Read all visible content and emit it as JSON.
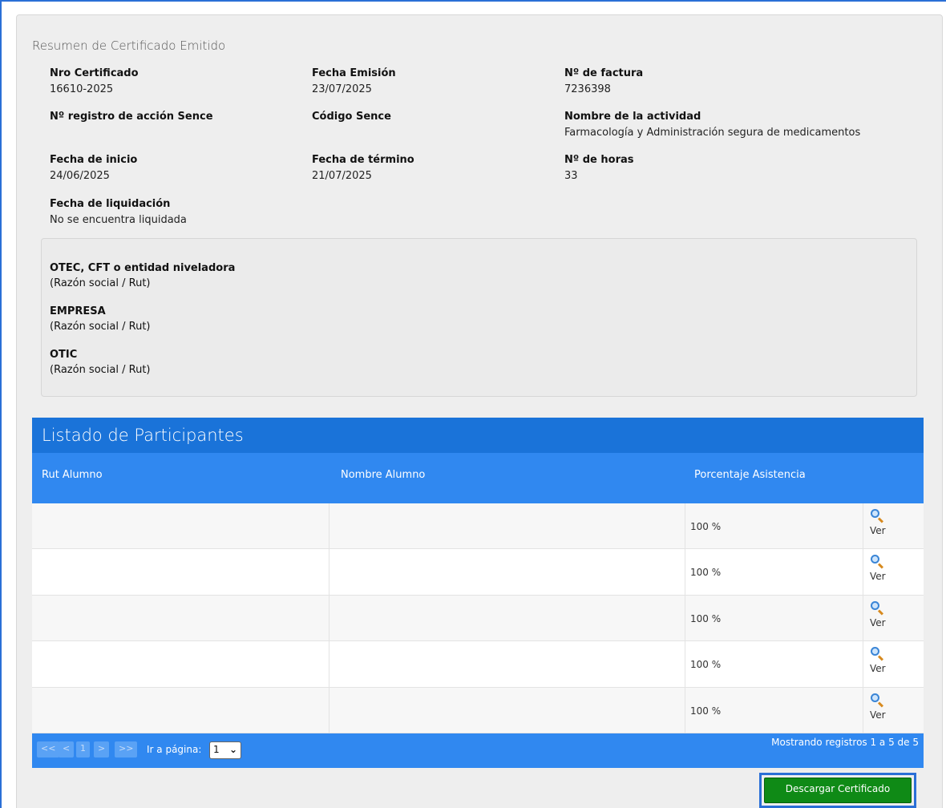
{
  "summary": {
    "title": "Resumen de Certificado Emitido",
    "fields": {
      "nro_certificado": {
        "label": "Nro Certificado",
        "value": "16610-2025"
      },
      "fecha_emision": {
        "label": "Fecha Emisión",
        "value": "23/07/2025"
      },
      "nro_factura": {
        "label": "Nº de factura",
        "value": "7236398"
      },
      "nro_registro_sence": {
        "label": "Nº registro de acción Sence",
        "value": ""
      },
      "codigo_sence": {
        "label": "Código Sence",
        "value": ""
      },
      "nombre_actividad": {
        "label": "Nombre de la actividad",
        "value": "Farmacología y Administración segura de medicamentos"
      },
      "fecha_inicio": {
        "label": "Fecha de inicio",
        "value": "24/06/2025"
      },
      "fecha_termino": {
        "label": "Fecha de término",
        "value": "21/07/2025"
      },
      "nro_horas": {
        "label": "Nº de horas",
        "value": "33"
      },
      "fecha_liquidacion": {
        "label": "Fecha de liquidación",
        "value": "No se encuentra liquidada"
      }
    }
  },
  "entities": [
    {
      "label": "OTEC, CFT o entidad niveladora",
      "sub": "(Razón social / Rut)"
    },
    {
      "label": "EMPRESA",
      "sub": "(Razón social / Rut)"
    },
    {
      "label": "OTIC",
      "sub": "(Razón social / Rut)"
    }
  ],
  "participants": {
    "title": "Listado de Participantes",
    "columns": [
      "Rut Alumno",
      "Nombre Alumno",
      "Porcentaje Asistencia"
    ],
    "rows": [
      {
        "rut": "",
        "nombre": "",
        "asistencia": "100 %",
        "action": "Ver"
      },
      {
        "rut": "",
        "nombre": "",
        "asistencia": "100 %",
        "action": "Ver"
      },
      {
        "rut": "",
        "nombre": "",
        "asistencia": "100 %",
        "action": "Ver"
      },
      {
        "rut": "",
        "nombre": "",
        "asistencia": "100 %",
        "action": "Ver"
      },
      {
        "rut": "",
        "nombre": "",
        "asistencia": "100 %",
        "action": "Ver"
      }
    ]
  },
  "pager": {
    "first": "<<",
    "prev": "<",
    "current": "1",
    "next": ">",
    "last": ">>",
    "goto_label": "Ir a página:",
    "selected_page": "1",
    "records_text": "Mostrando registros 1 a 5 de 5"
  },
  "actions": {
    "download_label": "Descargar Certificado"
  },
  "colors": {
    "header_blue": "#1a73d9",
    "column_blue": "#3088f0",
    "download_green": "#0f8a16"
  }
}
